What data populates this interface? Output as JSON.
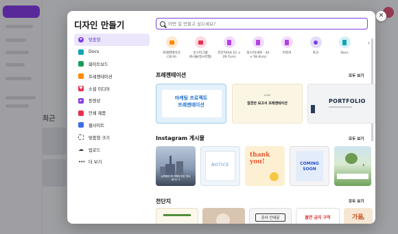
{
  "modal": {
    "title": "디자인 만들기",
    "close_symbol": "✕",
    "search_placeholder": "어떤 걸 만들고 싶으세요?"
  },
  "nav": [
    {
      "label": "맞춤형",
      "icon": "sparkle-icon",
      "color": "#7b3fe4"
    },
    {
      "label": "Docs",
      "icon": "docs-icon",
      "color": "#13a3b5"
    },
    {
      "label": "화이트보드",
      "icon": "whiteboard-icon",
      "color": "#1c9c5a"
    },
    {
      "label": "프레젠테이션",
      "icon": "presentation-icon",
      "color": "#ff8a00"
    },
    {
      "label": "소셜 미디어",
      "icon": "heart-icon",
      "color": "#e8304f"
    },
    {
      "label": "동영상",
      "icon": "video-icon",
      "color": "#8b3fe4"
    },
    {
      "label": "인쇄 제품",
      "icon": "print-icon",
      "color": "#e8304f"
    },
    {
      "label": "웹사이트",
      "icon": "website-icon",
      "color": "#3d6de6"
    },
    {
      "label": "맞춤형 크기",
      "icon": "resize-icon",
      "color": "#555555"
    },
    {
      "label": "업로드",
      "icon": "cloud-upload-icon",
      "color": "#555555"
    },
    {
      "label": "더 보기",
      "icon": "more-icon",
      "color": "#555555"
    }
  ],
  "categories": [
    {
      "label": "프레젠테이션\n(16:9)",
      "color": "#ff8a00",
      "bg": "#ffe8cc"
    },
    {
      "label": "인스타그램\n게시물(정사각형)",
      "color": "#e8304f",
      "bg": "#ffd9e0"
    },
    {
      "label": "전단지(A4 21 ×\n29.7cm)",
      "color": "#b13fe4",
      "bg": "#f1dcfb"
    },
    {
      "label": "포스터(세로 - 42\n× 59.4cm)",
      "color": "#b13fe4",
      "bg": "#f1dcfb"
    },
    {
      "label": "이력서",
      "color": "#b13fe4",
      "bg": "#f1dcfb"
    },
    {
      "label": "로고",
      "color": "#7b3fe4",
      "bg": "#e4dcfb"
    },
    {
      "label": "Docs",
      "color": "#13a3b5",
      "bg": "#d3f2f5"
    }
  ],
  "sections": {
    "presentation": {
      "title": "프레젠테이션",
      "see_all": "모두 보기"
    },
    "instagram": {
      "title": "Instagram 게시물",
      "see_all": "모두 보기"
    },
    "flyer": {
      "title": "전단지",
      "see_all": "모두 보기"
    }
  },
  "templates": {
    "pres1_line1": "마케팅 프로젝트",
    "pres1_line2": "프레젠테이션",
    "pres2_small": "ACME",
    "pres2_text": "깔끔한 보고서 프레젠테이션",
    "pres3_text": "PORTFOLIO",
    "insta1_text": "뉴욕에서 꼭 가봐야 하는 명소 BEST 5",
    "insta2_text": "NOTICE",
    "insta3_line1": "thank",
    "insta3_line2": "you!",
    "insta4_line1": "COMING",
    "insta4_line2": "SOON",
    "flyer3_text": "공사 안내문",
    "flyer4_text": "흡연 금지 구역",
    "flyer5_text": "가을"
  },
  "background": {
    "heading": "최근"
  }
}
